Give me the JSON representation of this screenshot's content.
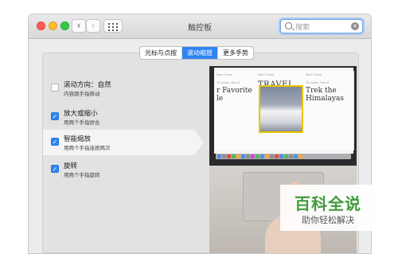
{
  "window": {
    "title": "触控板"
  },
  "toolbar": {
    "back_icon": "chevron-left-icon",
    "forward_icon": "chevron-right-icon",
    "grid_icon": "grid-icon",
    "back_glyph": "‹",
    "forward_glyph": "›"
  },
  "search": {
    "placeholder": "搜索",
    "icon": "search-icon"
  },
  "tabs": [
    {
      "label": "光标与点按",
      "active": false
    },
    {
      "label": "滚动缩放",
      "active": true
    },
    {
      "label": "更多手势",
      "active": false
    }
  ],
  "options": [
    {
      "title": "滚动方向：自然",
      "subtitle": "内容跟手指移动",
      "checked": false,
      "selected": false
    },
    {
      "title": "放大或缩小",
      "subtitle": "用两个手指捏合",
      "checked": true,
      "selected": false
    },
    {
      "title": "智能缩放",
      "subtitle": "用两个手指连按两次",
      "checked": true,
      "selected": true
    },
    {
      "title": "旋转",
      "subtitle": "用两个手指旋转",
      "checked": true,
      "selected": false
    }
  ],
  "preview": {
    "col1_date": "Thursday, May 6",
    "col1_heading": "r Favorite\nle",
    "col2_source": "More Travel",
    "col2_heading": "TRAVEL",
    "col3_source": "More Travel",
    "col3_date": "Thursday, May 6",
    "col3_heading": "Trek the Himalayas",
    "col1_source": "More Travel"
  },
  "watermark": {
    "line1": "百科全说",
    "line2": "助你轻松解决"
  },
  "colors": {
    "accent": "#2f85f3",
    "watermark_green": "#3f9b3a"
  }
}
